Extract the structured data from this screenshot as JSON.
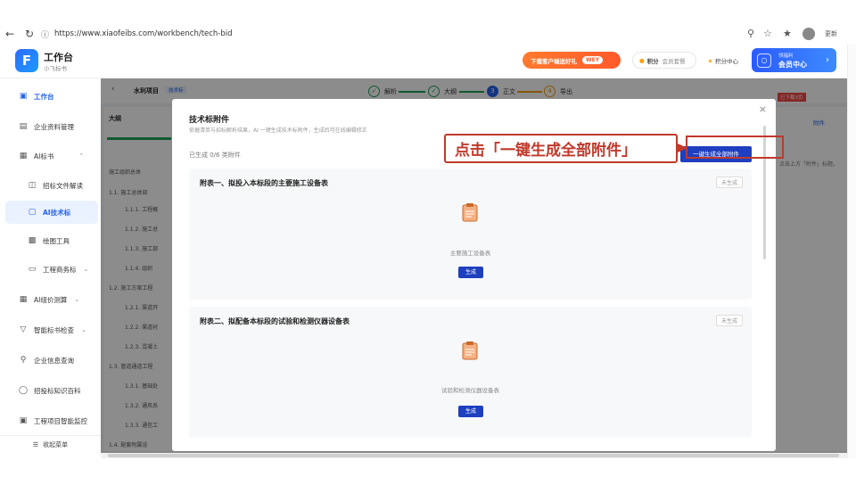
{
  "browser": {
    "url": "https://www.xiaofeibs.com/workbench/tech-bid",
    "update_label": "更新"
  },
  "app": {
    "title": "工作台",
    "subtitle": "小飞标书"
  },
  "header": {
    "promo_text": "下载客户端送好礼",
    "promo_tag": "WEY",
    "balance_label": "积分",
    "balance_value": "会员套餐",
    "points_center": "积分中心",
    "vip_small": "领福利",
    "vip_label": "会员中心"
  },
  "sidebar": {
    "items": [
      {
        "label": "工作台",
        "icon": "monitor-icon"
      },
      {
        "label": "企业资料管理",
        "icon": "briefcase-icon"
      },
      {
        "label": "AI标书",
        "icon": "document-icon"
      },
      {
        "label": "招标文件解读",
        "icon": "book-icon"
      },
      {
        "label": "AI技术标",
        "icon": "file-icon"
      },
      {
        "label": "绘图工具",
        "icon": "image-icon"
      },
      {
        "label": "工程商务标",
        "icon": "folder-icon"
      },
      {
        "label": "AI组价测算",
        "icon": "calculator-icon"
      },
      {
        "label": "智能标书检查",
        "icon": "filter-icon"
      },
      {
        "label": "企业信息查询",
        "icon": "search-icon"
      },
      {
        "label": "招投标知识百科",
        "icon": "chat-icon"
      },
      {
        "label": "工程项目智能监控",
        "icon": "monitor-icon"
      }
    ],
    "collapse_label": "收起菜单"
  },
  "steps": [
    {
      "label": "解析",
      "state": "done"
    },
    {
      "label": "大纲",
      "state": "done"
    },
    {
      "label": "正文",
      "state": "current"
    },
    {
      "label": "导出",
      "state": "todo"
    }
  ],
  "project": {
    "name": "水利项目",
    "tag": "技术标"
  },
  "outline": {
    "title": "大纲",
    "rows": [
      "施工组织总体",
      "1.1. 施工总体部",
      "1.1.1. 工程概",
      "1.1.2. 施工总",
      "1.1.3. 施工部",
      "1.1.4. 组织",
      "1.2. 施工方案工程",
      "1.2.1. 渠道开",
      "1.2.2. 渠道衬",
      "1.2.3. 混凝土",
      "1.3. 管道通道工程",
      "1.3.1. 基础处",
      "1.3.2. 通风系",
      "1.3.3. 通信工",
      "1.4. 配套附属设"
    ]
  },
  "right_panel": {
    "tab": "附件",
    "export_label": "已下载3页",
    "hint": "点击上方「附件」标题，"
  },
  "modal": {
    "title": "技术标附件",
    "desc": "依据清单与招标解析结果，AI 一键生成技术标附件，生成后可在线编辑修正",
    "status": "已生成 0/6 类附件",
    "generate_all": "一键生成全部附件",
    "close_icon": "close-icon",
    "cards": [
      {
        "title": "附表一、拟投入本标段的主要施工设备表",
        "badge": "未生成",
        "label": "主要施工设备表",
        "button": "生成"
      },
      {
        "title": "附表二、拟配备本标段的试验和检测仪器设备表",
        "badge": "未生成",
        "label": "试验和检测仪器设备表",
        "button": "生成"
      }
    ]
  },
  "annotation": {
    "text": "点击「一键生成全部附件」",
    "color": "#c0392b"
  },
  "colors": {
    "primary": "#1e3fbf",
    "accent": "#2563eb",
    "success": "#22a35a",
    "promo": "#ff5a2a"
  }
}
